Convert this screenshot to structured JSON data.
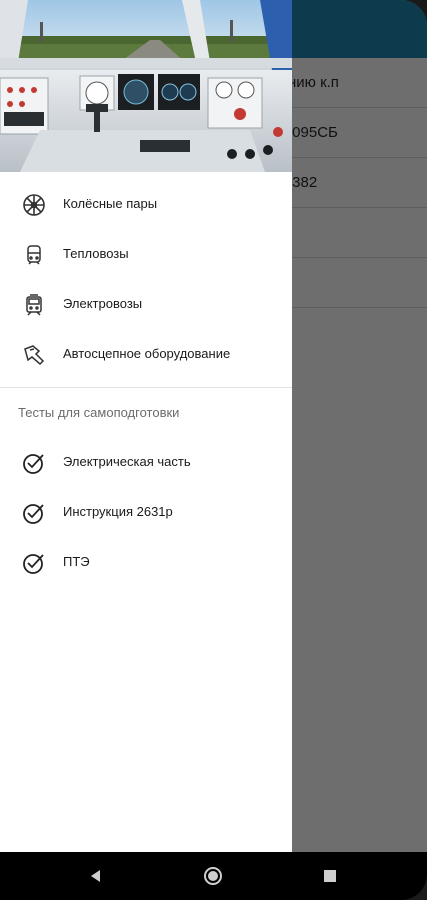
{
  "background": {
    "rows": [
      {
        "text": "нию к.п"
      },
      {
        "text": ".095СБ"
      },
      {
        "text": ".382"
      },
      {
        "text": ""
      },
      {
        "text": ""
      }
    ]
  },
  "drawer": {
    "items": [
      {
        "label": "Колёсные пары",
        "icon": "wheel-icon"
      },
      {
        "label": "Тепловозы",
        "icon": "diesel-locomotive-icon"
      },
      {
        "label": "Электровозы",
        "icon": "electric-locomotive-icon"
      },
      {
        "label": "Автосцепное оборудование",
        "icon": "coupler-icon"
      }
    ],
    "section_title": "Тесты для самоподготовки",
    "tests": [
      {
        "label": "Электрическая часть",
        "icon": "check-circle-icon"
      },
      {
        "label": "Инструкция 2631р",
        "icon": "check-circle-icon"
      },
      {
        "label": "ПТЭ",
        "icon": "check-circle-icon"
      }
    ]
  },
  "colors": {
    "appbar": "#0d3b4d",
    "scrim": "#6e6e6e",
    "drawer_bg": "#ffffff"
  }
}
